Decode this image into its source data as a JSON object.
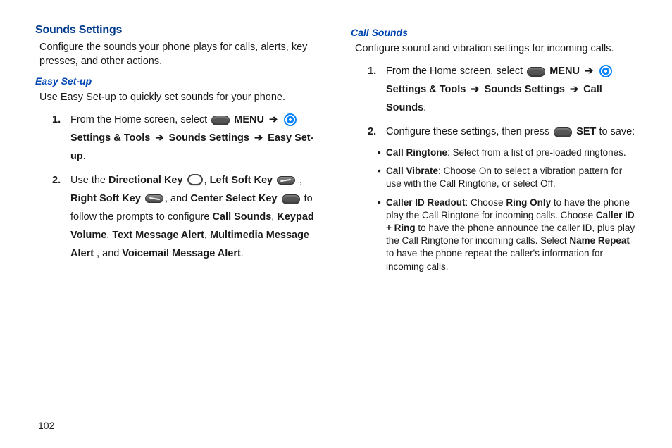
{
  "pageNumber": "102",
  "left": {
    "title": "Sounds Settings",
    "intro": "Configure the sounds your phone plays for calls, alerts, key presses, and other actions.",
    "sub": {
      "title": "Easy Set-up",
      "intro": "Use Easy Set-up to quickly set sounds for your phone.",
      "step1": {
        "num": "1.",
        "a": "From the Home screen, select ",
        "menu": "MENU",
        "st": "Settings & Tools",
        "ss": "Sounds Settings",
        "es": "Easy Set-up"
      },
      "step2": {
        "num": "2.",
        "a": "Use the ",
        "dir": "Directional Key",
        "lsk": "Left Soft Key",
        "rsk": "Right Soft Key",
        "csk": "Center Select Key",
        "mid": " to follow the prompts to configure ",
        "cs": "Call Sounds",
        "kv": "Keypad Volume",
        "tma": "Text Message Alert",
        "mma": "Multimedia Message Alert",
        "and": ", and ",
        "vma": "Voicemail Message Alert"
      }
    }
  },
  "right": {
    "title": "Call Sounds",
    "intro": "Configure sound and vibration settings for incoming calls.",
    "step1": {
      "num": "1.",
      "a": "From the Home screen, select ",
      "menu": "MENU",
      "st": "Settings & Tools",
      "ss": "Sounds Settings",
      "cs": "Call Sounds"
    },
    "step2": {
      "num": "2.",
      "a": "Configure these settings, then press ",
      "set": "SET",
      "b": " to save:"
    },
    "bullets": {
      "b1": {
        "t": "Call Ringtone",
        "d": ": Select from a list of pre-loaded ringtones."
      },
      "b2": {
        "t": "Call Vibrate",
        "d": ": Choose On to select a vibration pattern for use with the Call Ringtone, or select Off."
      },
      "b3": {
        "t": "Caller ID Readout",
        "d1": ": Choose ",
        "ro": "Ring Only",
        "d2": " to have the phone play the Call Ringtone for incoming calls. Choose ",
        "cir": "Caller ID + Ring",
        "d3": " to have the phone announce the caller ID, plus play the Call Ringtone for incoming calls. Select ",
        "nr": "Name Repeat",
        "d4": " to have the phone repeat the caller's information for incoming calls."
      }
    }
  }
}
